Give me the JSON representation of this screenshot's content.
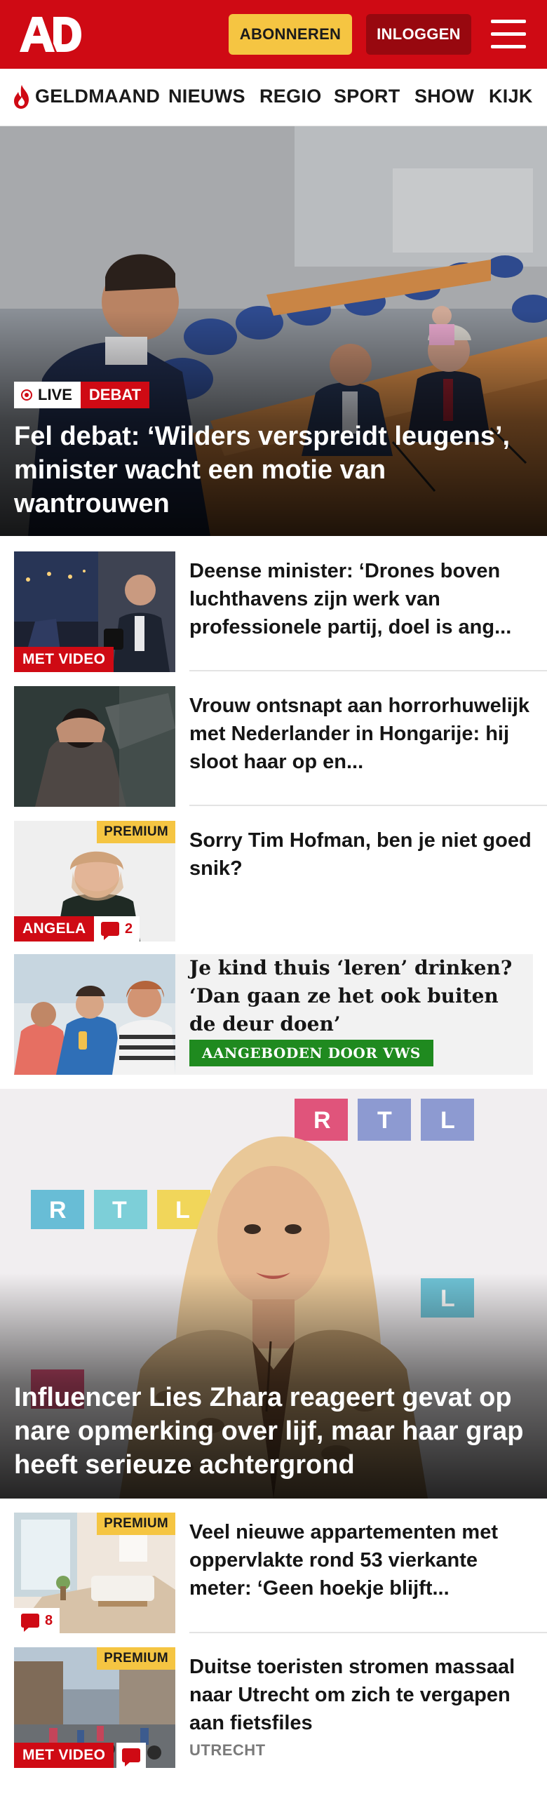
{
  "header": {
    "logo_text": "AD",
    "subscribe_label": "ABONNEREN",
    "login_label": "INLOGGEN",
    "menu_icon": "hamburger-menu-icon",
    "brand_color": "#cf0a14"
  },
  "nav": {
    "items": [
      {
        "label": "GELDMAAND",
        "icon": "flame-icon"
      },
      {
        "label": "NIEUWS"
      },
      {
        "label": "REGIO"
      },
      {
        "label": "SPORT"
      },
      {
        "label": "SHOW"
      },
      {
        "label": "KIJK"
      }
    ]
  },
  "hero": {
    "live_label": "LIVE",
    "tag": "DEBAT",
    "title": "Fel debat: ‘Wilders verspreidt leugens’, minister wacht een motie van wantrouwen"
  },
  "articles": [
    {
      "title": "Deense minister: ‘Drones boven luchthavens zijn werk van professionele partij, doel is ang...",
      "label": "MET VIDEO"
    },
    {
      "title": "Vrouw ontsnapt aan horrorhuwe­lijk met Nederlander in Hongarije: hij sloot haar op en..."
    },
    {
      "title": "Sorry Tim Hofman, ben je niet goed snik?",
      "premium": "PREMIUM",
      "label": "ANGELA",
      "comments": "2"
    }
  ],
  "ad": {
    "title": "Je kind thuis ‘leren’ drinken? ‘Dan gaan ze het ook buiten de deur doen’",
    "label": "AANGEBODEN DOOR VWS"
  },
  "hero2": {
    "title": "Influencer Lies Zhara reageert gevat op nare opmerking over lijf, maar haar grap heeft serieuze achtergrond"
  },
  "articles2": [
    {
      "title": "Veel nieuwe appartementen met oppervlakte rond 53 vierkante meter: ‘Geen hoekje blijft...",
      "premium": "PREMIUM",
      "comments": "8"
    },
    {
      "title": "Duitse toeristen stromen massaal naar Utrecht om zich te vergapen aan fietsfiles",
      "premium": "PREMIUM",
      "label": "MET VIDEO",
      "tagline": "UTRECHT"
    }
  ]
}
